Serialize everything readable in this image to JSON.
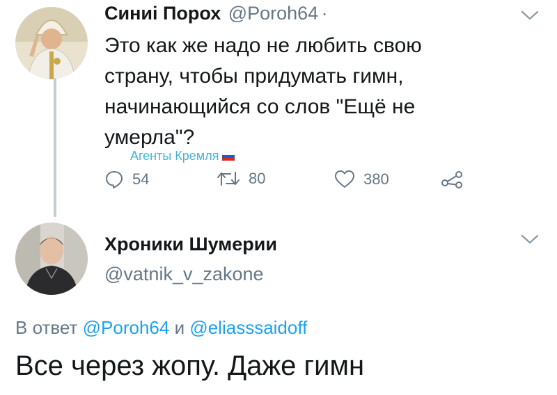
{
  "tweet1": {
    "author_name": "Синиі Порох",
    "author_handle": "@Poroh64",
    "separator": "·",
    "text_lines": [
      "Это как же надо не любить свою",
      "страну, чтобы придумать гимн,",
      "начинающийся со слов \"Ещё не",
      "умерла\"?"
    ],
    "watermark": "Агенты Кремля",
    "actions": {
      "replies": "54",
      "retweets": "80",
      "likes": "380"
    }
  },
  "tweet2": {
    "author_name": "Хроники Шумерии",
    "author_handle": "@vatnik_v_zakone",
    "reply_prefix": "В ответ",
    "reply_user1": "@Poroh64",
    "reply_and": "и",
    "reply_user2": "@eliasssaidoff",
    "text": "Все через жопу. Даже гимн"
  },
  "colors": {
    "text": "#14171a",
    "secondary": "#657786",
    "link": "#1da1f2",
    "thread_line": "#c4ccd4"
  }
}
